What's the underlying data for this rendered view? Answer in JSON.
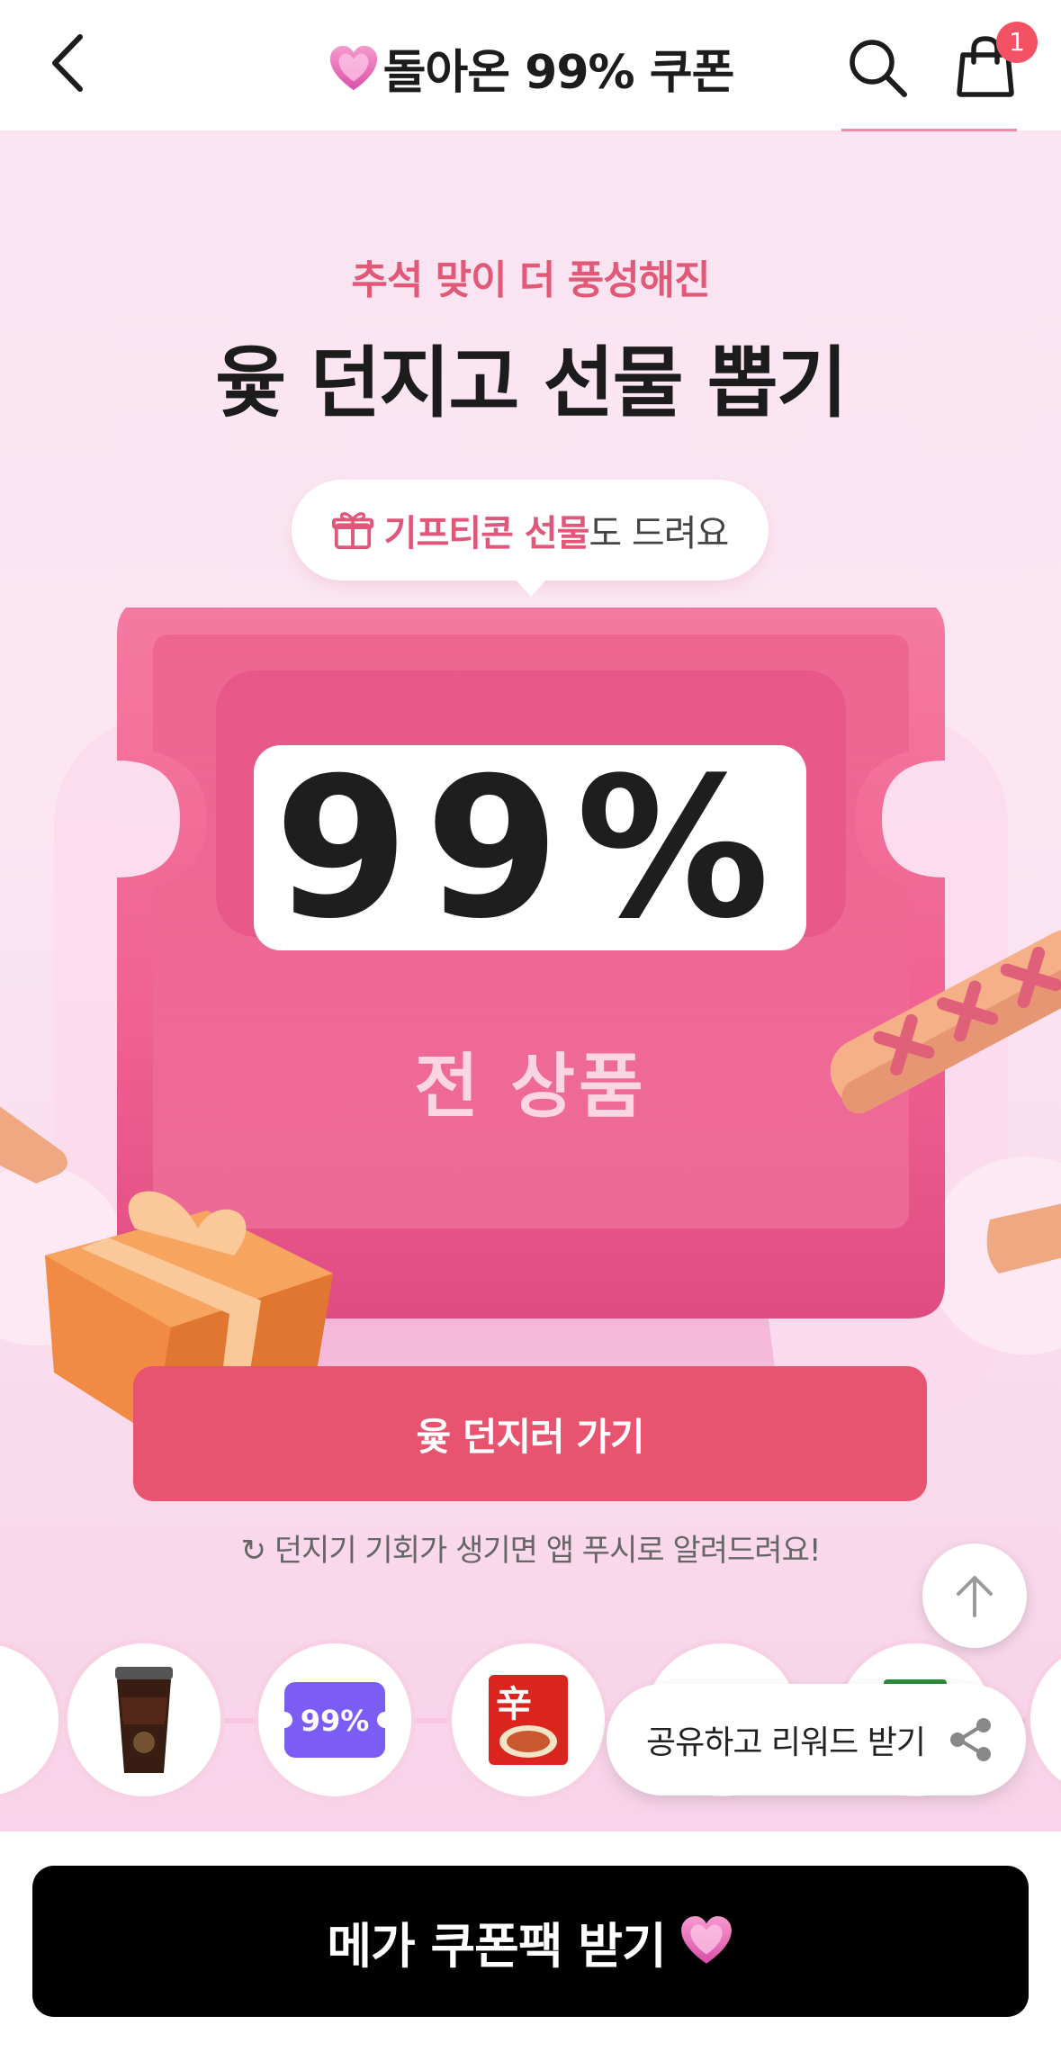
{
  "header": {
    "title": "돌아온 99% 쿠폰",
    "cart_count": "1",
    "icons": [
      "back-icon",
      "heart-icon",
      "search-icon",
      "shopping-bag-icon"
    ]
  },
  "hero": {
    "subtitle": "추석 맞이 더 풍성해진",
    "title": "윷 던지고 선물 뽑기",
    "bubble": {
      "highlight": "기프티콘 선물",
      "rest": "도 드려요"
    },
    "percent": "99%",
    "all_products": "전 상품",
    "cta_label": "윷 던지러 가기",
    "notice": "↻ 던지기 기회가 생기면 앱 푸시로 알려드려요!"
  },
  "prizes": [
    {
      "name": "prize-partial-left"
    },
    {
      "name": "iced-coffee"
    },
    {
      "name": "99-percent-coupon",
      "label": "99%"
    },
    {
      "name": "shin-ramyun",
      "label": "辛"
    },
    {
      "name": "prize-hidden"
    },
    {
      "name": "prize-green-item"
    },
    {
      "name": "prize-partial-right"
    }
  ],
  "share": {
    "label": "공유하고 리워드 받기"
  },
  "bottom": {
    "mega_label": "메가 쿠폰팩 받기"
  },
  "colors": {
    "accent": "#e85470",
    "subtitle_pink": "#e25978",
    "badge": "#f25263",
    "coupon_purple": "#7b5cf5",
    "hero_bg": "#fbe4f1"
  }
}
